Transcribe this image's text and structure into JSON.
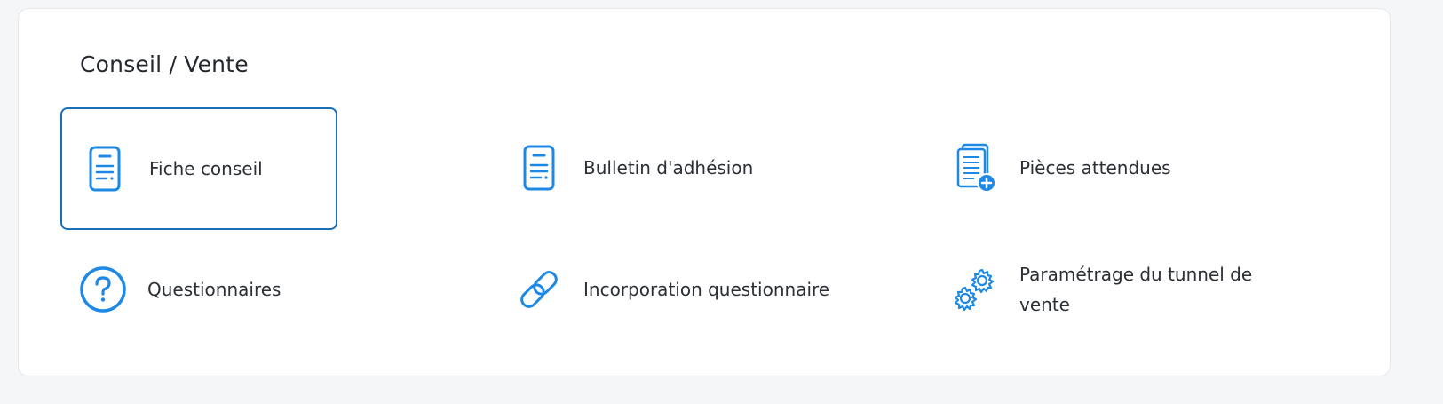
{
  "section": {
    "title": "Conseil / Vente"
  },
  "accent_color": "#1e88e5",
  "items": [
    {
      "label": "Fiche conseil",
      "icon": "document-icon",
      "selected": true
    },
    {
      "label": "Bulletin d'adhésion",
      "icon": "document-icon",
      "selected": false
    },
    {
      "label": "Pièces attendues",
      "icon": "document-add-icon",
      "selected": false
    },
    {
      "label": "Questionnaires",
      "icon": "question-circle-icon",
      "selected": false
    },
    {
      "label": "Incorporation questionnaire",
      "icon": "link-icon",
      "selected": false
    },
    {
      "label": "Paramétrage du tunnel de vente",
      "icon": "gears-icon",
      "selected": false
    }
  ]
}
